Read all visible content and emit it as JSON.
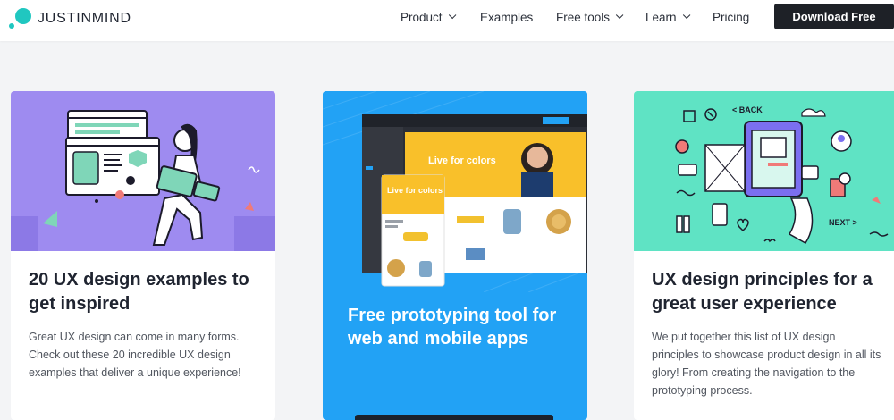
{
  "header": {
    "logo_text": "JUSTINMIND",
    "nav": [
      {
        "label": "Product",
        "dropdown": true
      },
      {
        "label": "Examples",
        "dropdown": false
      },
      {
        "label": "Free tools",
        "dropdown": true
      },
      {
        "label": "Learn",
        "dropdown": true
      },
      {
        "label": "Pricing",
        "dropdown": false
      }
    ],
    "download_label": "Download Free"
  },
  "cards": [
    {
      "title": "20 UX design examples to get inspired",
      "description": "Great UX design can come in many forms. Check out these 20 incredible UX design examples that deliver a unique experience!",
      "hero_color": "#9e8bf0"
    },
    {
      "title": "Free prototyping tool for web and mobile apps",
      "hero_color": "#22a2f5",
      "mockup": {
        "banner_text": "Live for colors",
        "mobile_text": "Live for colors"
      }
    },
    {
      "title": "UX design principles for a great user experience",
      "description": "We put together this list of UX design principles to showcase product design in all its glory! From creating the navigation to the prototyping process.",
      "hero_color": "#5fe3c4",
      "illustration_labels": {
        "back": "< BACK",
        "next": "NEXT >"
      }
    }
  ],
  "colors": {
    "brand_teal": "#20c7c0",
    "dark_button": "#1e2127",
    "page_bg": "#f3f4f6"
  }
}
